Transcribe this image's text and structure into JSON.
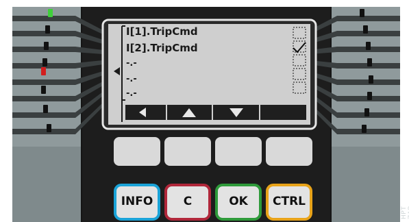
{
  "screen": {
    "lines": [
      "I[1].TripCmd",
      "I[2].TripCmd",
      "-.-",
      "-.-",
      "-.-"
    ],
    "checked_row": 1
  },
  "softkeys": [
    {
      "icon": "arrow-left-icon"
    },
    {
      "icon": "arrow-up-icon"
    },
    {
      "icon": "arrow-down-icon"
    },
    {
      "icon": "blank"
    }
  ],
  "buttons": {
    "info": "INFO",
    "c": "C",
    "ok": "OK",
    "ctrl": "CTRL"
  },
  "button_colors": {
    "info": "#1aa3d8",
    "c": "#b0273a",
    "ok": "#2e9a3a",
    "ctrl": "#e8a319"
  },
  "leds": {
    "left": [
      "green",
      "off",
      "off",
      "off",
      "red",
      "off",
      "off",
      "off"
    ]
  },
  "watermark": "HPT ZAB"
}
